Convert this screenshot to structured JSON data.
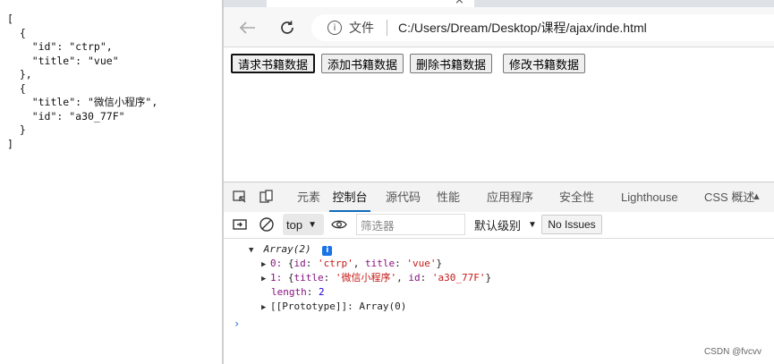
{
  "json_output": "[\n  {\n    \"id\": \"ctrp\",\n    \"title\": \"vue\"\n  },\n  {\n    \"title\": \"微信小程序\",\n    \"id\": \"a30_77F\"\n  }\n]",
  "address": {
    "file_label": "文件",
    "url": "C:/Users/Dream/Desktop/课程/ajax/inde.html"
  },
  "page": {
    "buttons": [
      "请求书籍数据",
      "添加书籍数据",
      "删除书籍数据",
      "修改书籍数据"
    ]
  },
  "devtools": {
    "tabs": [
      "元素",
      "控制台",
      "源代码",
      "性能",
      "应用程序",
      "安全性",
      "Lighthouse",
      "CSS 概述"
    ],
    "active_tab": "控制台",
    "context": "top",
    "filter_placeholder": "筛选器",
    "level": "默认级别",
    "issues": "No Issues"
  },
  "console": {
    "array_label": "Array(2)",
    "info_badge": "i",
    "item0_index": "0",
    "item0": {
      "id": "ctrp",
      "title": "vue"
    },
    "item1_index": "1",
    "item1": {
      "title": "微信小程序",
      "id": "a30_77F"
    },
    "length_key": "length",
    "length_value": "2",
    "prototype": "[[Prototype]]: Array(0)"
  },
  "watermark": "CSDN @fvcvv"
}
